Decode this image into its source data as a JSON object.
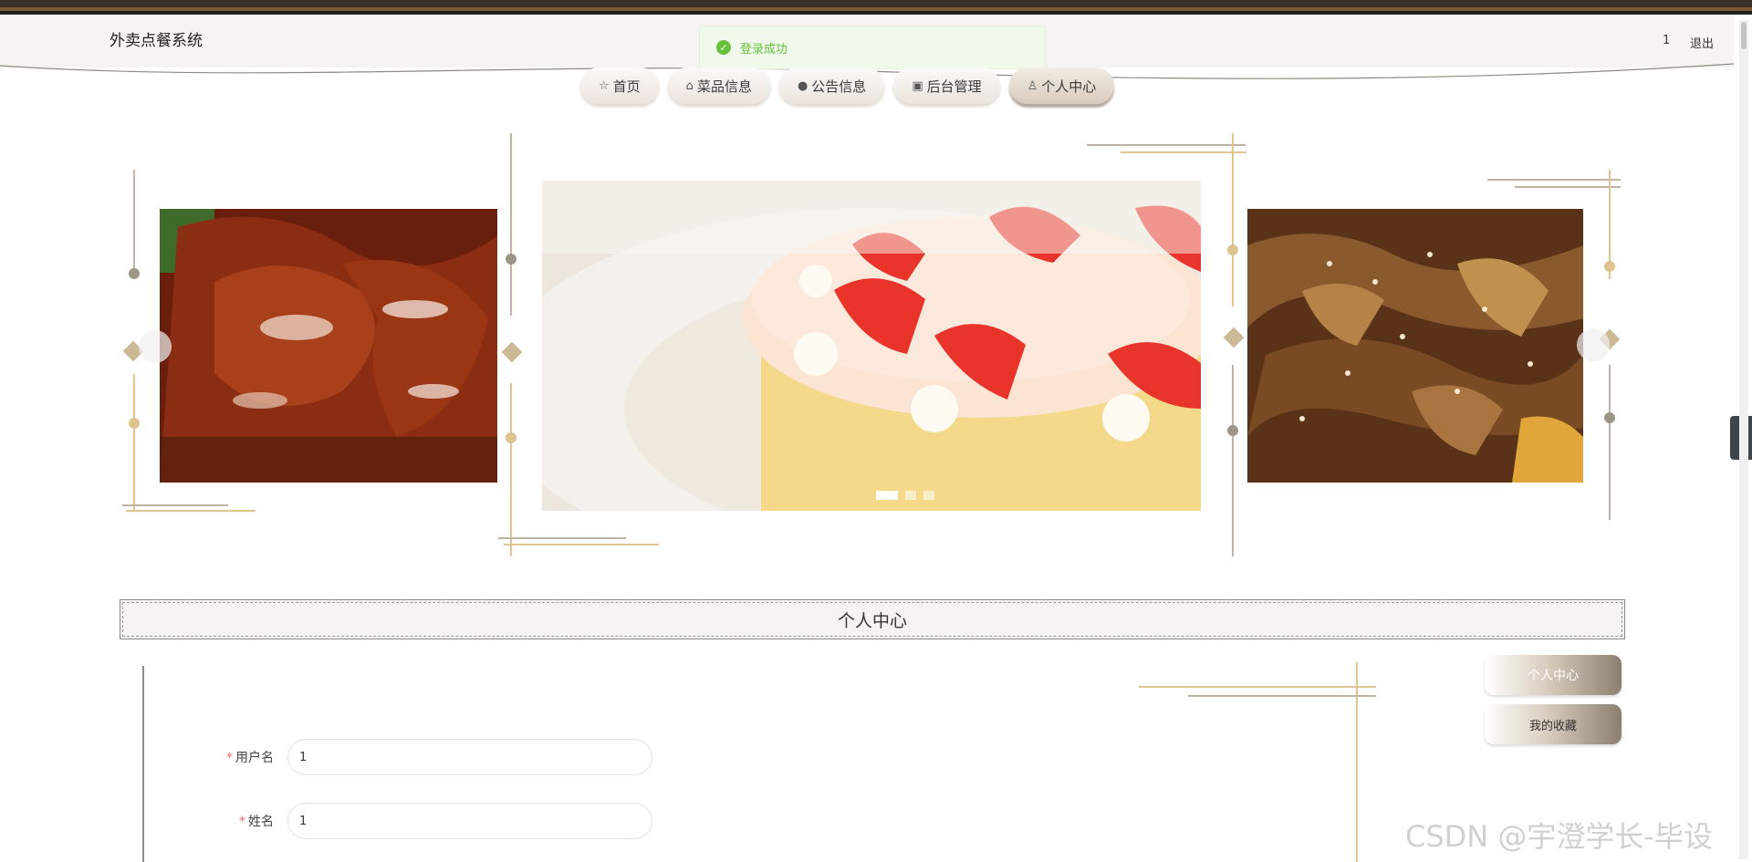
{
  "header": {
    "site_title": "外卖点餐系统",
    "user_name": "1",
    "logout_label": "退出"
  },
  "toast": {
    "message": "登录成功",
    "type": "success"
  },
  "nav": {
    "items": [
      {
        "label": "首页",
        "icon": "star-icon"
      },
      {
        "label": "菜品信息",
        "icon": "bag-icon"
      },
      {
        "label": "公告信息",
        "icon": "alert-icon"
      },
      {
        "label": "后台管理",
        "icon": "briefcase-icon"
      },
      {
        "label": "个人中心",
        "icon": "user-icon",
        "active": true
      }
    ]
  },
  "carousel": {
    "slides": [
      "roast-duck",
      "strawberry-cake",
      "braised-beef"
    ],
    "active_index": 0,
    "indicator_count": 3
  },
  "section": {
    "title": "个人中心"
  },
  "form": {
    "username_label": "用户名",
    "username_value": "1",
    "name_label": "姓名",
    "name_value": "1"
  },
  "side_menu": {
    "items": [
      "个人中心",
      "我的收藏"
    ]
  },
  "watermark": "CSDN @宇澄学长-毕设",
  "colors": {
    "accent_brown": "#8c7f70",
    "gold": "#dfc38f",
    "success": "#67c23a",
    "required": "#f56c6c"
  }
}
